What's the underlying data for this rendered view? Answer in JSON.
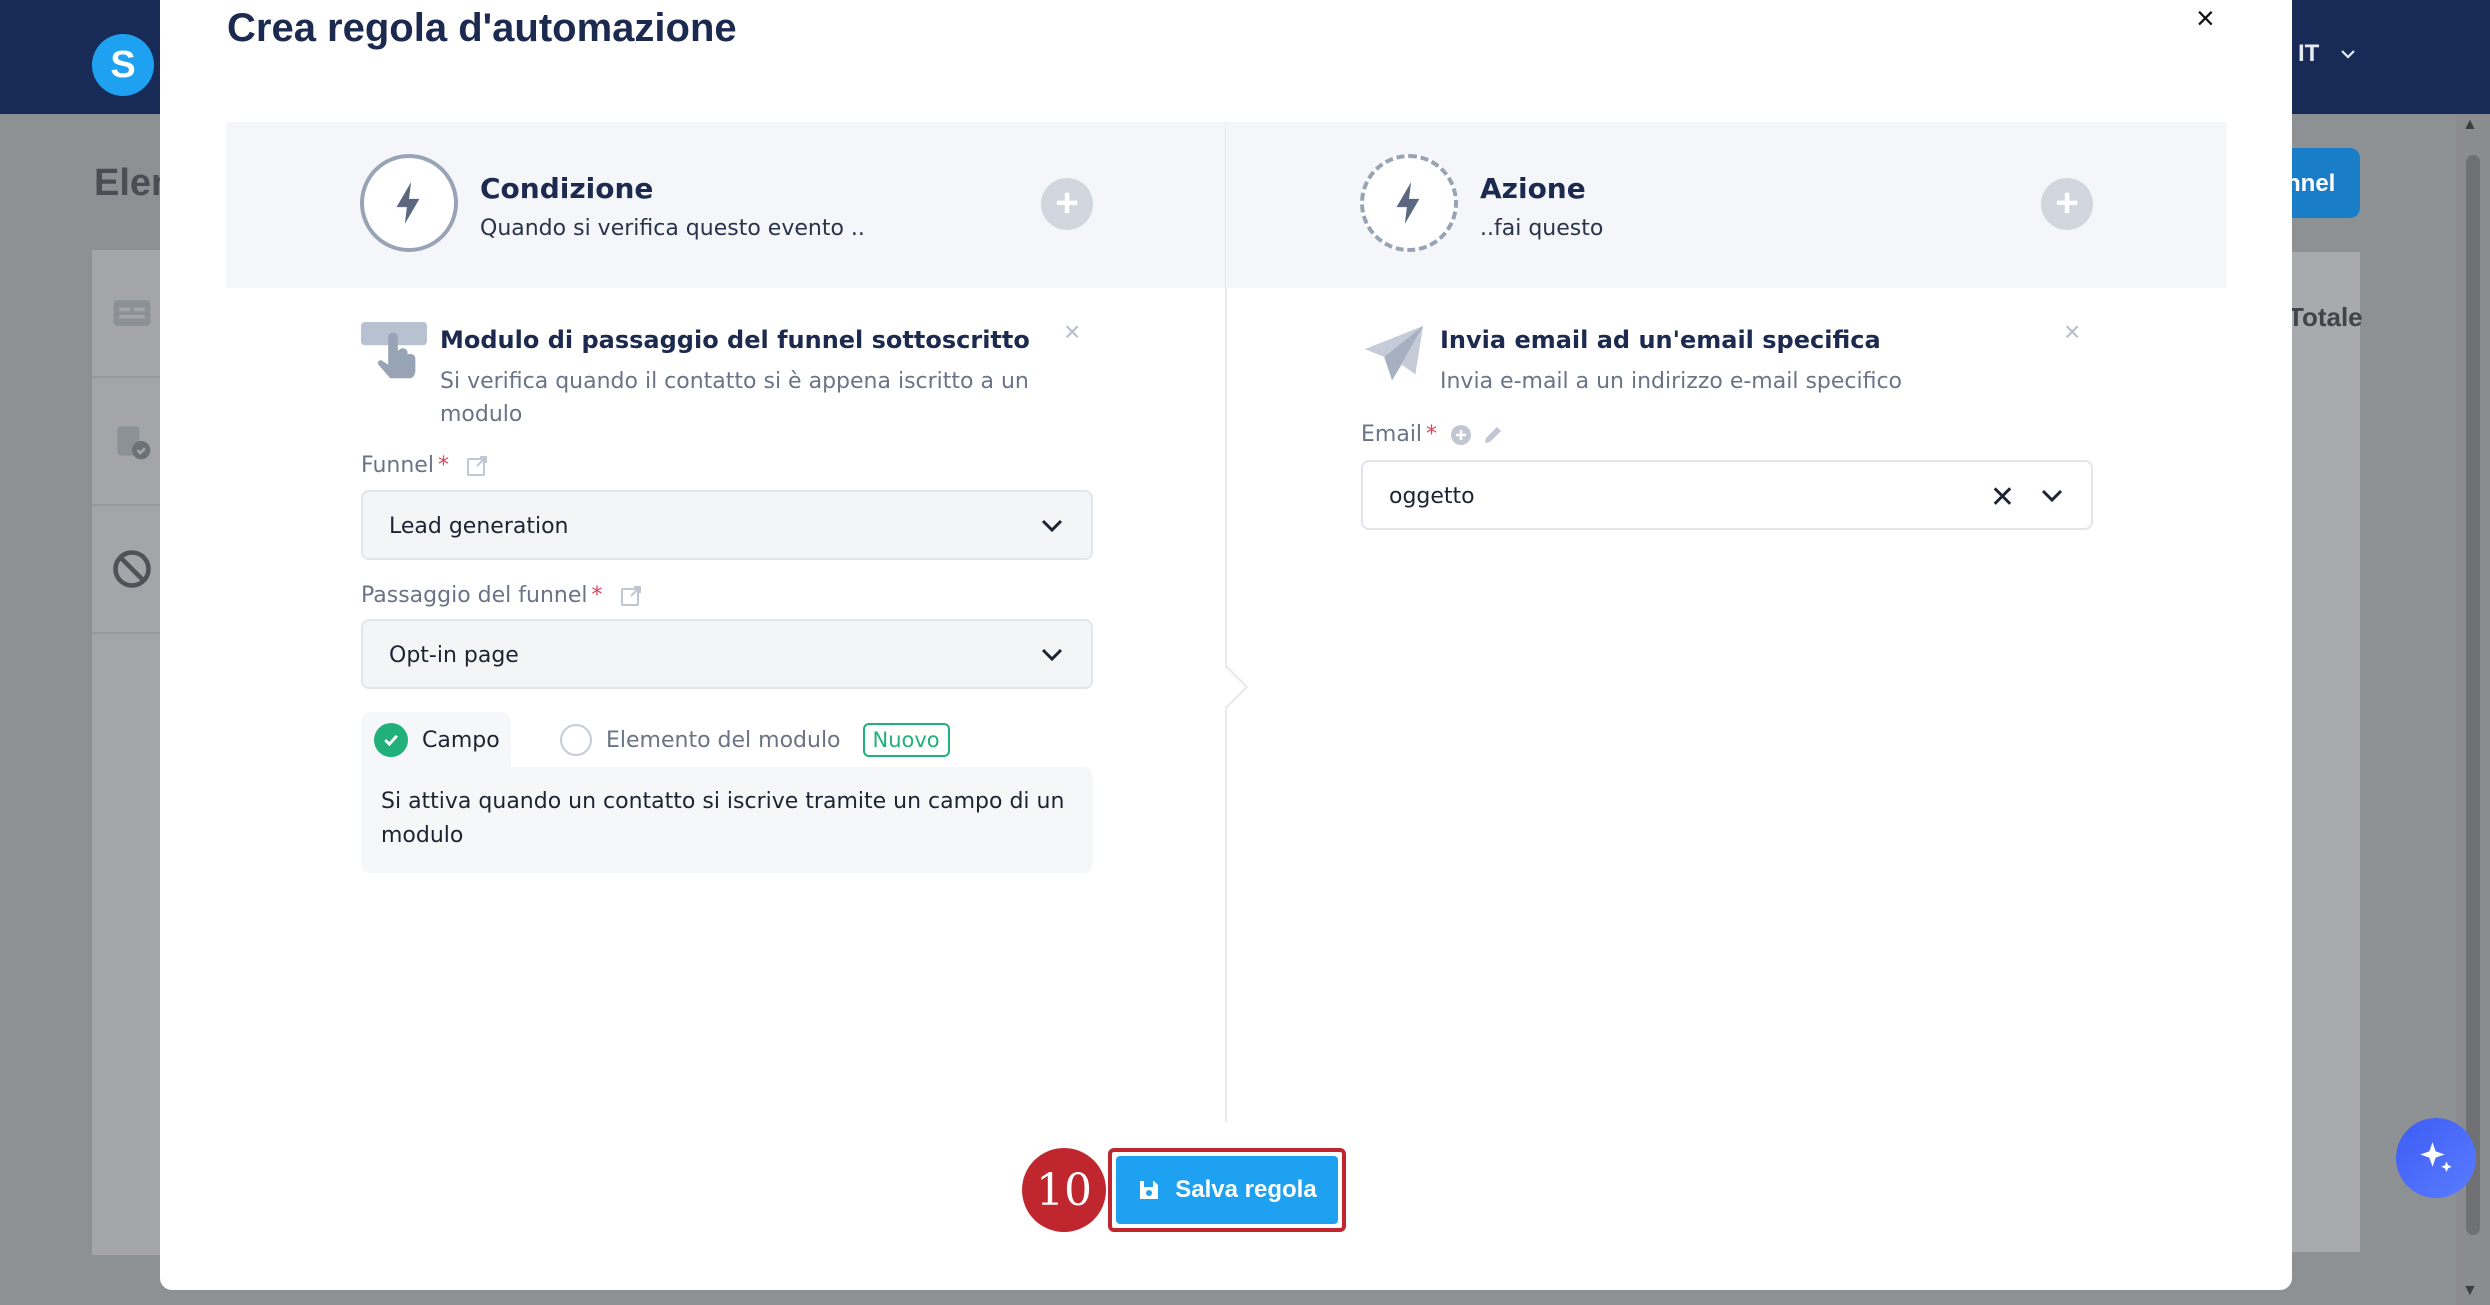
{
  "app": {
    "logo_letter": "S",
    "language": "IT",
    "background_title": "Elen",
    "background_button": "nnel",
    "background_column": "Totale"
  },
  "modal": {
    "title": "Crea regola d'automazione",
    "close_label": "×"
  },
  "condition": {
    "title": "Condizione",
    "subtitle": "Quando si verifica questo evento ..",
    "add_label": "+",
    "trigger": {
      "title": "Modulo di passaggio del funnel sottoscritto",
      "description": "Si verifica quando il contatto si è appena iscritto a un modulo",
      "remove_label": "×"
    },
    "funnel": {
      "label": "Funnel",
      "required": "*",
      "value": "Lead generation"
    },
    "funnel_step": {
      "label": "Passaggio del funnel",
      "required": "*",
      "value": "Opt-in page"
    },
    "tabs": [
      {
        "label": "Campo",
        "selected": true
      },
      {
        "label": "Elemento del modulo",
        "selected": false,
        "badge": "Nuovo"
      }
    ],
    "tab_description": "Si attiva quando un contatto si iscrive tramite un campo di un modulo"
  },
  "action": {
    "title": "Azione",
    "subtitle": "..fai questo",
    "add_label": "+",
    "item": {
      "title": "Invia email ad un'email specifica",
      "description": "Invia e-mail a un indirizzo e-mail specifico",
      "remove_label": "×"
    },
    "email": {
      "label": "Email",
      "required": "*",
      "value": "oggetto",
      "clear_label": "✕"
    }
  },
  "footer": {
    "save_label": "Salva regola",
    "step_number": "10"
  },
  "colors": {
    "primary": "#1ea1f1",
    "success": "#21b07a",
    "highlight": "#c0262e",
    "navy": "#182b57"
  }
}
